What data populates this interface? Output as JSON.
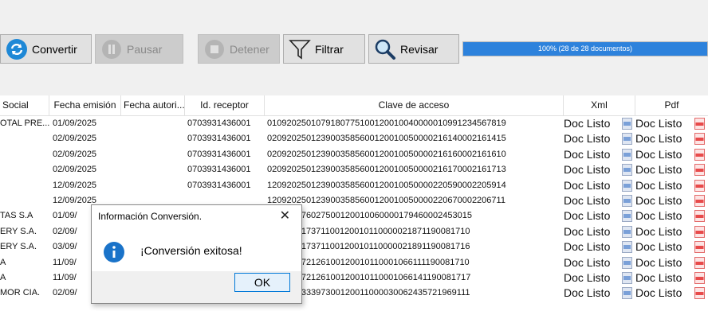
{
  "toolbar": {
    "convertir": "Convertir",
    "pausar": "Pausar",
    "detener": "Detener",
    "filtrar": "Filtrar",
    "revisar": "Revisar",
    "progress_text": "100% (28 de 28 documentos)",
    "progress_fraction": 1.0
  },
  "columns": [
    "Social",
    "Fecha emisión",
    "Fecha autori...",
    "Id. receptor",
    "Clave de acceso",
    "Xml",
    "Pdf"
  ],
  "rows": [
    {
      "social": "OTAL PRE...",
      "fecha": "01/09/2025",
      "receptor": "0703931436001",
      "clave": "0109202501079180775100120010040000010991234567819",
      "xml": "Doc Listo",
      "pdf": "Doc Listo"
    },
    {
      "social": "",
      "fecha": "02/09/2025",
      "receptor": "0703931436001",
      "clave": "0209202501239003585600120010050000216140002161415",
      "xml": "Doc Listo",
      "pdf": "Doc Listo"
    },
    {
      "social": "",
      "fecha": "02/09/2025",
      "receptor": "0703931436001",
      "clave": "0209202501239003585600120010050000216160002161610",
      "xml": "Doc Listo",
      "pdf": "Doc Listo"
    },
    {
      "social": "",
      "fecha": "02/09/2025",
      "receptor": "0703931436001",
      "clave": "0209202501239003585600120010050000216170002161713",
      "xml": "Doc Listo",
      "pdf": "Doc Listo"
    },
    {
      "social": "",
      "fecha": "12/09/2025",
      "receptor": "0703931436001",
      "clave": "1209202501239003585600120010050000220590002205914",
      "xml": "Doc Listo",
      "pdf": "Doc Listo"
    },
    {
      "social": "",
      "fecha": "12/09/2025",
      "receptor": "",
      "clave": "1209202501239003585600120010050000220670002206711",
      "xml": "Doc Listo",
      "pdf": "Doc Listo"
    },
    {
      "social": "TAS S.A",
      "fecha": "01/09/",
      "receptor": "",
      "clave": "501079176027500120010060000179460002453015",
      "xml": "Doc Listo",
      "pdf": "Doc Listo"
    },
    {
      "social": "ERY S.A.",
      "fecha": "02/09/",
      "receptor": "",
      "clave": "501099317371100120010110000021871190081710",
      "xml": "Doc Listo",
      "pdf": "Doc Listo"
    },
    {
      "social": "ERY S.A.",
      "fecha": "03/09/",
      "receptor": "",
      "clave": "501099317371100120010110000021891190081716",
      "xml": "Doc Listo",
      "pdf": "Doc Listo"
    },
    {
      "social": "A",
      "fecha": "11/09/",
      "receptor": "",
      "clave": "501079172126100120010110001066111190081710",
      "xml": "Doc Listo",
      "pdf": "Doc Listo"
    },
    {
      "social": "A",
      "fecha": "11/09/",
      "receptor": "",
      "clave": "501079172126100120010110001066141190081717",
      "xml": "Doc Listo",
      "pdf": "Doc Listo"
    },
    {
      "social": "MOR CIA.",
      "fecha": "02/09/",
      "receptor": "",
      "clave": "501019033397300120011000030062435721969111",
      "xml": "Doc Listo",
      "pdf": "Doc Listo"
    }
  ],
  "dialog": {
    "title": "Información Conversión.",
    "close": "✕",
    "message": "¡Conversión exitosa!",
    "ok": "OK"
  }
}
